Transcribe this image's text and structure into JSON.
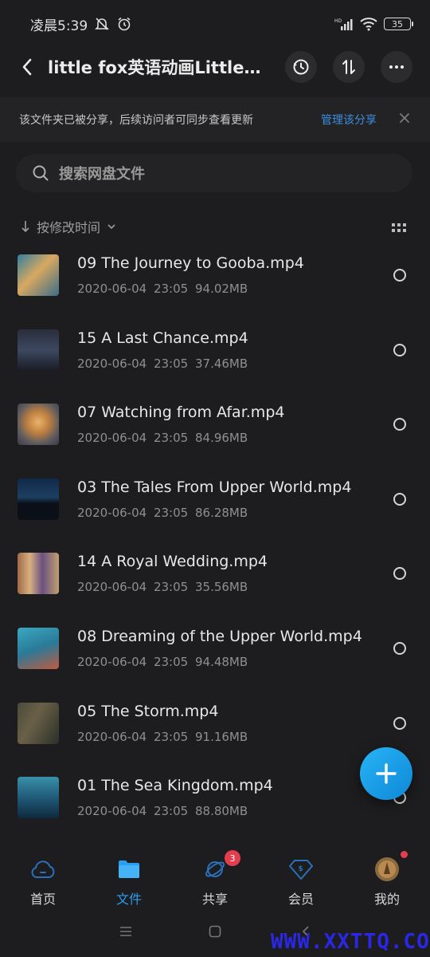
{
  "status_bar": {
    "time": "凌晨5:39",
    "battery": "35",
    "icons": [
      "dnd-off-icon",
      "alarm-icon",
      "signal-icon",
      "wifi-icon",
      "battery-icon"
    ]
  },
  "header": {
    "title": "little fox英语动画Little...",
    "back_icon": "chevron-left-icon",
    "actions": [
      "history-icon",
      "sort-icon",
      "more-icon"
    ]
  },
  "banner": {
    "text": "该文件夹已被分享，后续访问者可同步查看更新",
    "link": "管理该分享"
  },
  "search": {
    "placeholder": "搜索网盘文件"
  },
  "sort": {
    "label": "按修改时间"
  },
  "files": [
    {
      "name": "09 The Journey to Gooba.mp4",
      "date": "2020-06-04",
      "time": "23:05",
      "size": "94.02MB"
    },
    {
      "name": "15 A Last Chance.mp4",
      "date": "2020-06-04",
      "time": "23:05",
      "size": "37.46MB"
    },
    {
      "name": "07 Watching from Afar.mp4",
      "date": "2020-06-04",
      "time": "23:05",
      "size": "84.96MB"
    },
    {
      "name": "03 The Tales From Upper World.mp4",
      "date": "2020-06-04",
      "time": "23:05",
      "size": "86.28MB"
    },
    {
      "name": "14 A Royal Wedding.mp4",
      "date": "2020-06-04",
      "time": "23:05",
      "size": "35.56MB"
    },
    {
      "name": "08 Dreaming of the Upper World.mp4",
      "date": "2020-06-04",
      "time": "23:05",
      "size": "94.48MB"
    },
    {
      "name": "05 The Storm.mp4",
      "date": "2020-06-04",
      "time": "23:05",
      "size": "91.16MB"
    },
    {
      "name": "01 The Sea Kingdom.mp4",
      "date": "2020-06-04",
      "time": "23:05",
      "size": "88.80MB"
    }
  ],
  "nav": {
    "home": "首页",
    "files": "文件",
    "share": "共享",
    "vip": "会员",
    "me": "我的",
    "share_badge": "3"
  },
  "watermark": "WWW.XXTTQ.COM",
  "colors": {
    "accent": "#2a9ef0",
    "background": "#1d1d1f",
    "badge": "#e33e4f"
  }
}
